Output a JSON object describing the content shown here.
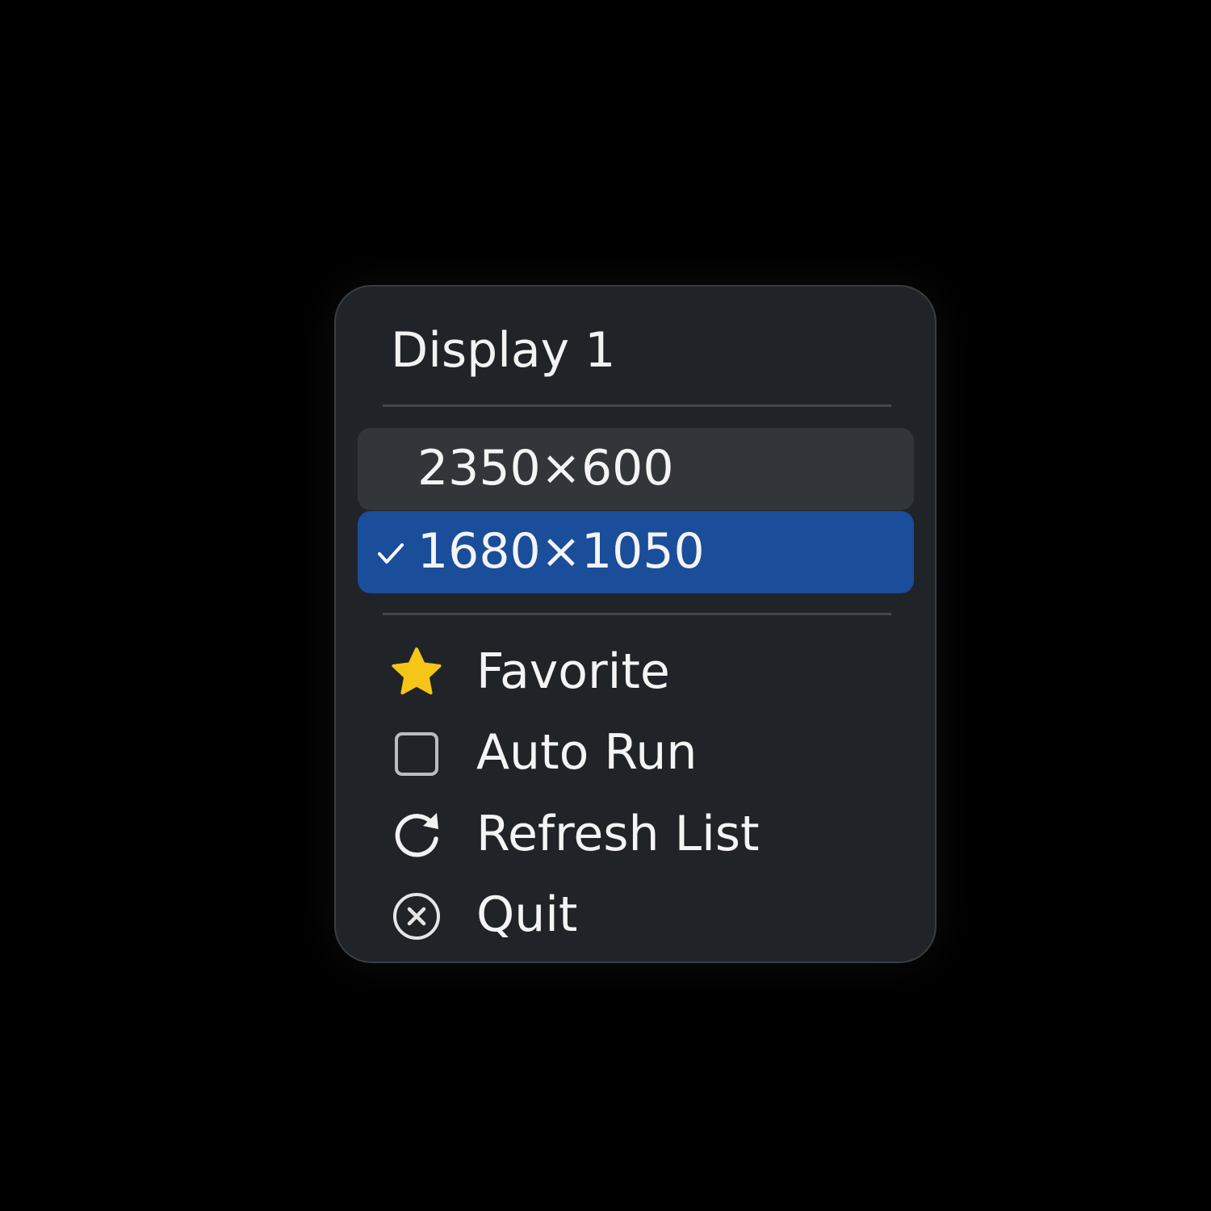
{
  "menu": {
    "title": "Display 1",
    "resolutions": [
      {
        "label": "2350×600",
        "selected": false
      },
      {
        "label": "1680×1050",
        "selected": true
      }
    ],
    "actions": [
      {
        "label": "Favorite",
        "icon": "star-icon"
      },
      {
        "label": "Auto Run",
        "icon": "checkbox-icon",
        "checked": false
      },
      {
        "label": "Refresh List",
        "icon": "refresh-icon"
      },
      {
        "label": "Quit",
        "icon": "close-circle-icon"
      }
    ]
  },
  "colors": {
    "background": "#000000",
    "menu_background": "#202328",
    "hover_row": "#32363b",
    "selected_row": "#1a4d9a",
    "star": "#f5c518",
    "text": "#f4f4f4"
  }
}
